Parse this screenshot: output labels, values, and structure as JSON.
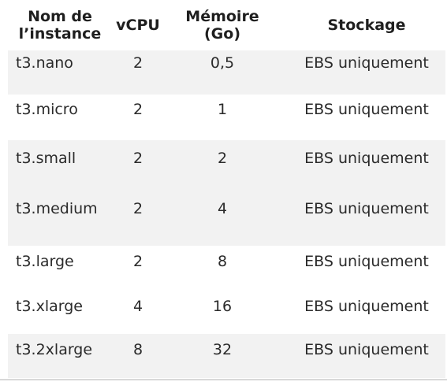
{
  "table": {
    "headers": [
      "Nom de\nl’instance",
      "vCPU",
      "Mémoire\n(Go)",
      "Stockage"
    ],
    "rows": [
      {
        "name": "t3.nano",
        "vcpu": "2",
        "memory": "0,5",
        "storage": "EBS uniquement",
        "shaded": true
      },
      {
        "name": "t3.micro",
        "vcpu": "2",
        "memory": "1",
        "storage": "EBS uniquement",
        "shaded": false
      },
      {
        "name": "t3.small",
        "vcpu": "2",
        "memory": "2",
        "storage": "EBS uniquement",
        "shaded": true
      },
      {
        "name": "t3.medium",
        "vcpu": "2",
        "memory": "4",
        "storage": "EBS uniquement",
        "shaded": true
      },
      {
        "name": "t3.large",
        "vcpu": "2",
        "memory": "8",
        "storage": "EBS uniquement",
        "shaded": false
      },
      {
        "name": "t3.xlarge",
        "vcpu": "4",
        "memory": "16",
        "storage": "EBS uniquement",
        "shaded": false
      },
      {
        "name": "t3.2xlarge",
        "vcpu": "8",
        "memory": "32",
        "storage": "EBS uniquement",
        "shaded": true
      }
    ]
  },
  "colors": {
    "row_shade": "#f2f2f2",
    "text": "#2a2a2a"
  }
}
